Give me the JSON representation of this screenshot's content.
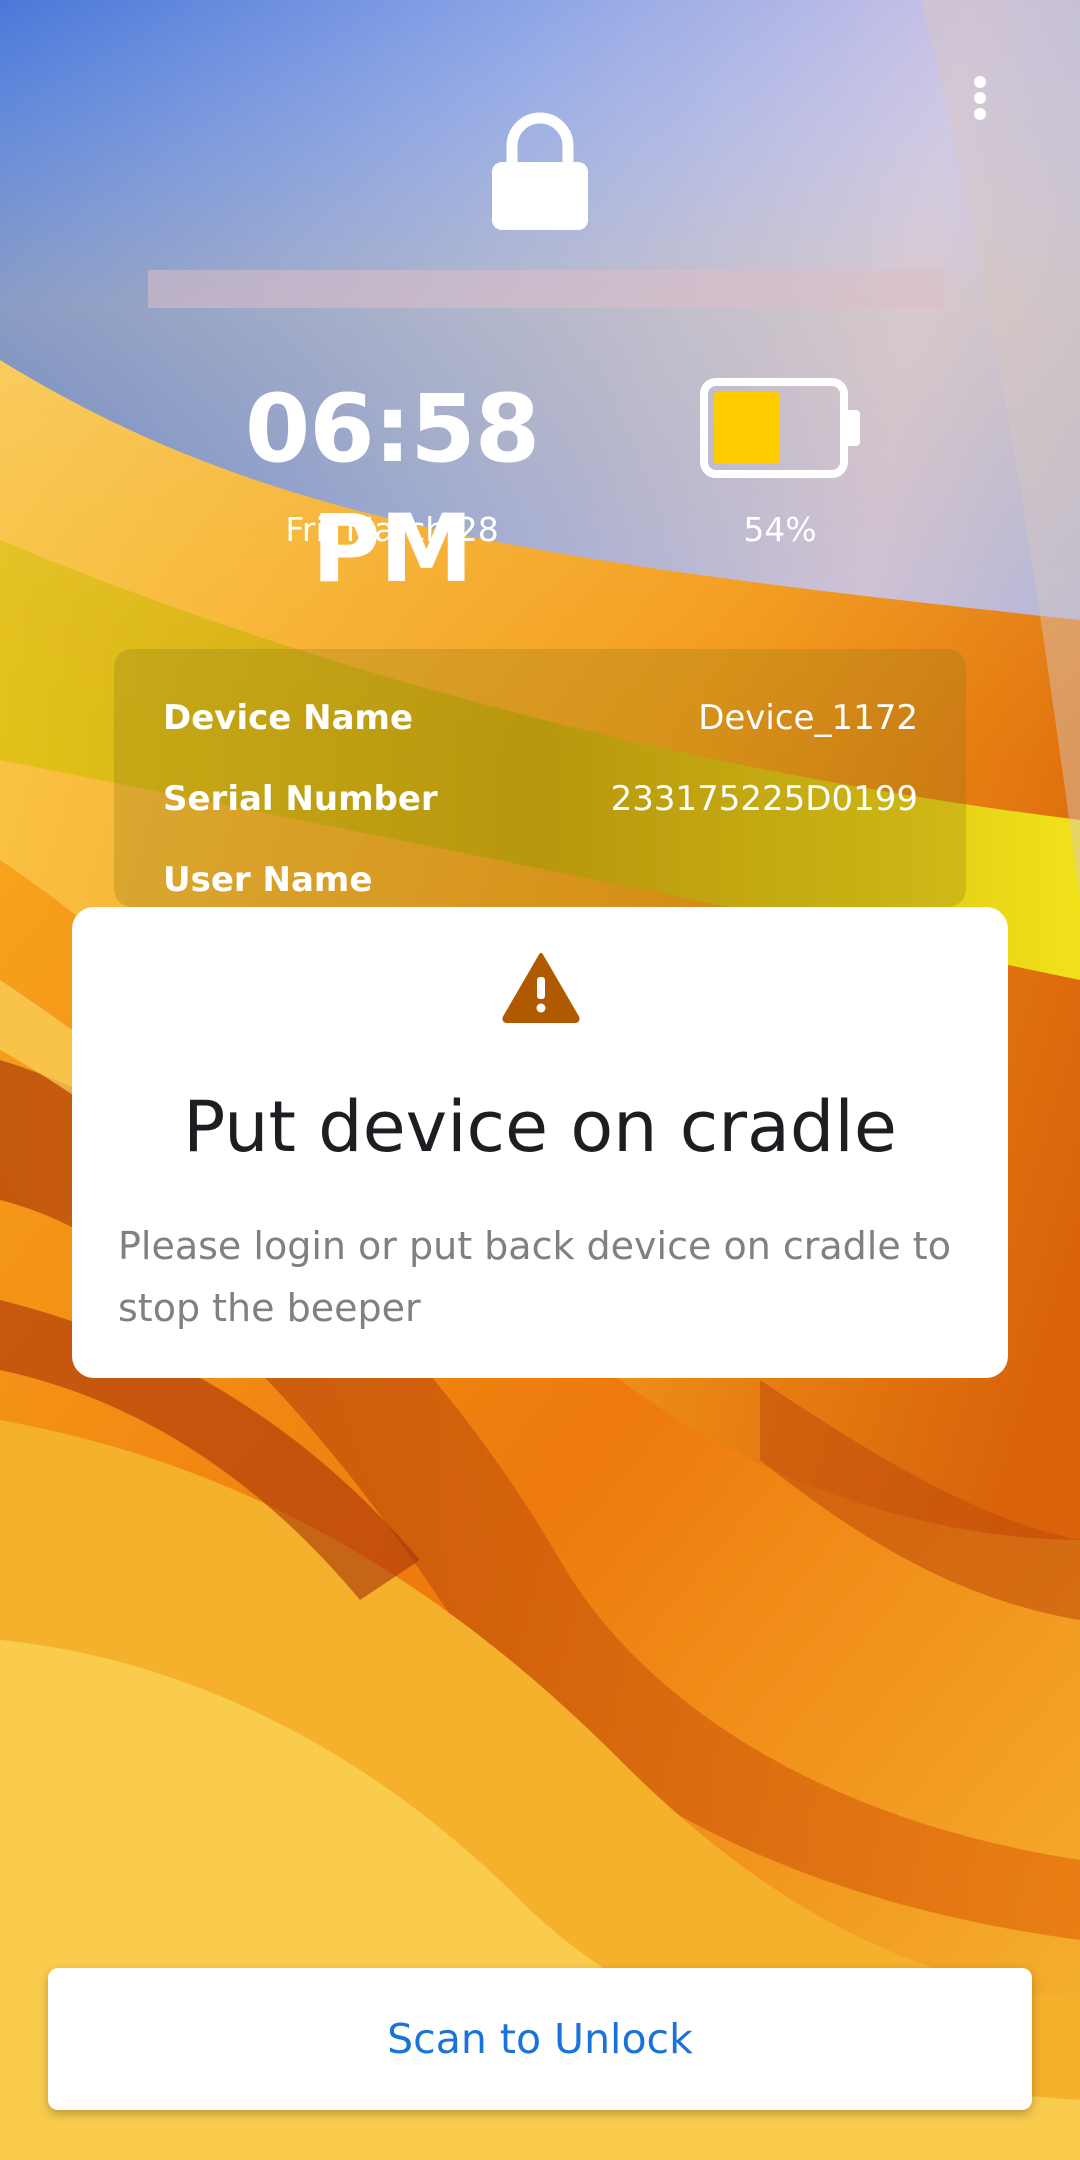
{
  "colors": {
    "button_text": "#1a73d9",
    "battery_fill": "#ffcc00",
    "warning_icon": "#b05a00",
    "alert_title": "#1d1d22",
    "alert_message": "#808080"
  },
  "header": {
    "menu_icon": "more-vert-icon",
    "lock_icon": "lock-icon"
  },
  "status": {
    "time": "06:58 PM",
    "date": "Fri, March 28",
    "battery_level": 0.54,
    "battery_percent": "54%"
  },
  "device_info": {
    "rows": [
      {
        "label": "Device Name",
        "value": "Device_1172"
      },
      {
        "label": "Serial Number",
        "value": "233175225D0199"
      },
      {
        "label": "User Name",
        "value": ""
      }
    ]
  },
  "alert": {
    "icon": "warning-icon",
    "title": "Put device on cradle",
    "message": "Please login or put back device on cradle to stop the beeper"
  },
  "action": {
    "scan_label": "Scan to Unlock"
  }
}
